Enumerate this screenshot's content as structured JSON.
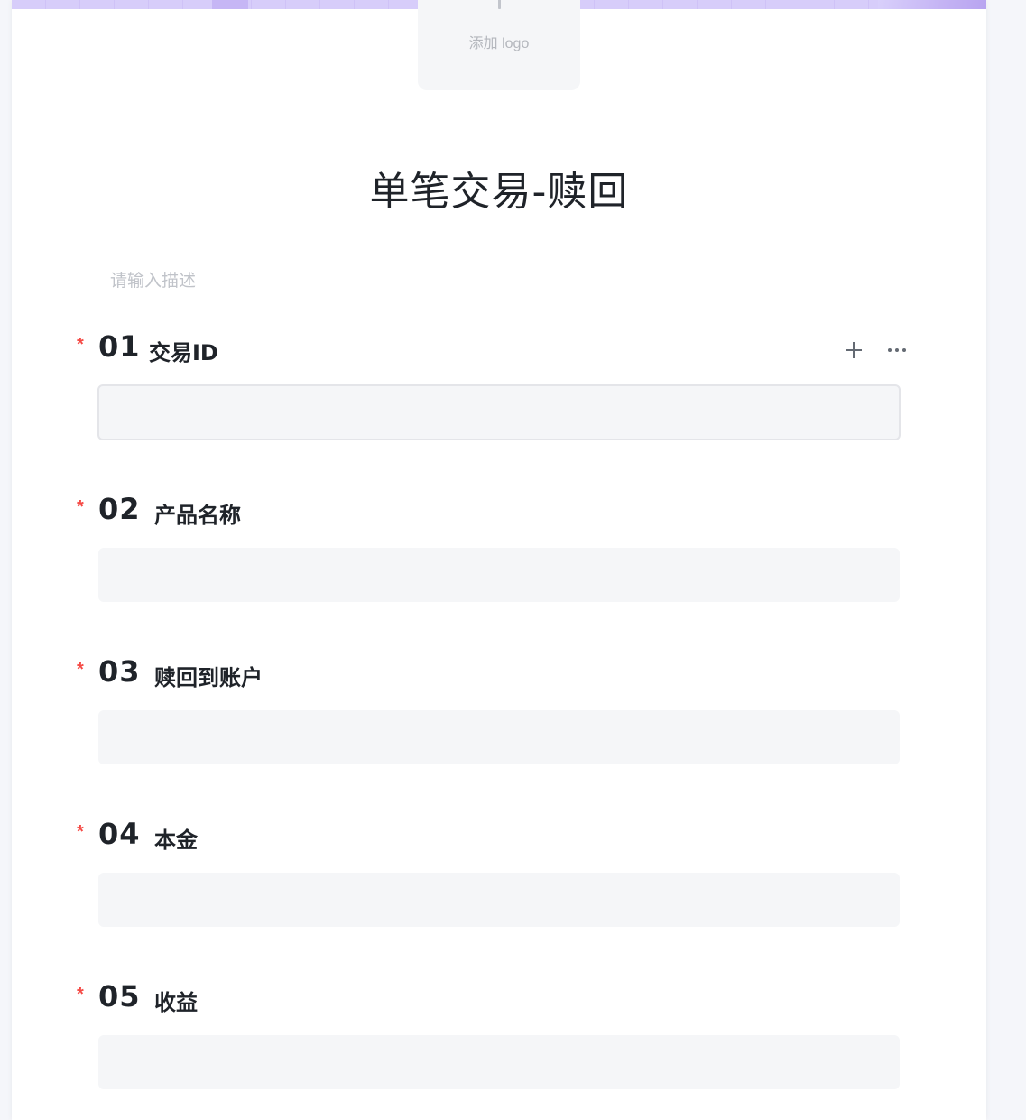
{
  "header": {
    "logo_label": "添加 logo"
  },
  "form": {
    "title": "单笔交易-赎回",
    "description_placeholder": "请输入描述"
  },
  "questions": [
    {
      "number": "01",
      "label": "交易ID",
      "required_mark": "*",
      "value": ""
    },
    {
      "number": "02",
      "label": "产品名称",
      "required_mark": "*",
      "value": ""
    },
    {
      "number": "03",
      "label": "赎回到账户",
      "required_mark": "*",
      "value": ""
    },
    {
      "number": "04",
      "label": "本金",
      "required_mark": "*",
      "value": ""
    },
    {
      "number": "05",
      "label": "收益",
      "required_mark": "*",
      "value": ""
    }
  ],
  "toolbar_icons": [
    "plus-icon",
    "more-icon"
  ],
  "colors": {
    "required": "#f54a45",
    "banner": "#d9d0fb",
    "input_bg": "#f5f6f8",
    "text": "#1f2329",
    "placeholder": "#c0c3c9"
  }
}
